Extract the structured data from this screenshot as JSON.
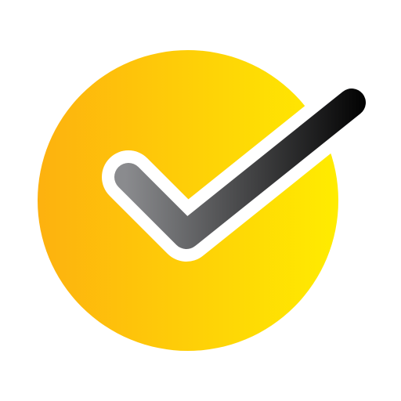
{
  "icon": {
    "name": "checkmark-circle-icon",
    "colors": {
      "circle_gradient_start": "#FDB10F",
      "circle_gradient_end": "#FFEC00",
      "check_gradient_start": "#8A8B8E",
      "check_gradient_end": "#000000",
      "check_outline": "#FFFFFF",
      "background": "#FFFFFF"
    }
  }
}
